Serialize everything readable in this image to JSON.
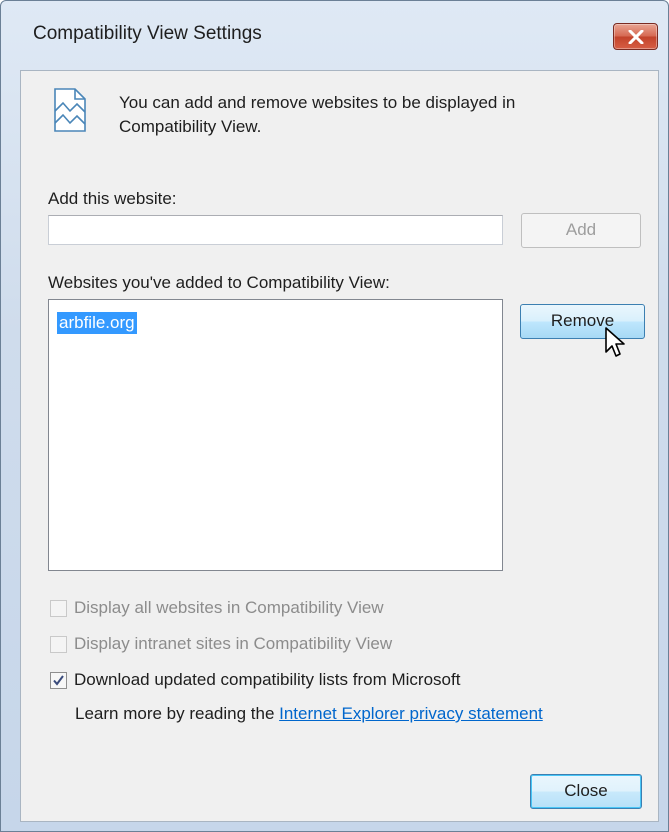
{
  "window": {
    "title": "Compatibility View Settings",
    "close_icon": "close-x-icon"
  },
  "intro": {
    "icon": "broken-page-icon",
    "text": "You can add and remove websites to be displayed in Compatibility View."
  },
  "add_section": {
    "label": "Add this website:",
    "input_value": "",
    "add_button": "Add"
  },
  "list_section": {
    "label": "Websites you've added to Compatibility View:",
    "items": [
      "arbfile.org"
    ],
    "remove_button": "Remove"
  },
  "options": [
    {
      "label": "Display all websites in Compatibility View",
      "checked": false,
      "enabled": false
    },
    {
      "label": "Display intranet sites in Compatibility View",
      "checked": false,
      "enabled": false
    },
    {
      "label": "Download updated compatibility lists from Microsoft",
      "checked": true,
      "enabled": true
    }
  ],
  "learn_more": {
    "prefix": "Learn more by reading the ",
    "link_text": "Internet Explorer privacy statement"
  },
  "footer": {
    "close_button": "Close"
  },
  "colors": {
    "selection": "#3399ff",
    "link": "#0066cc",
    "close_button_red": "#c2432b"
  }
}
